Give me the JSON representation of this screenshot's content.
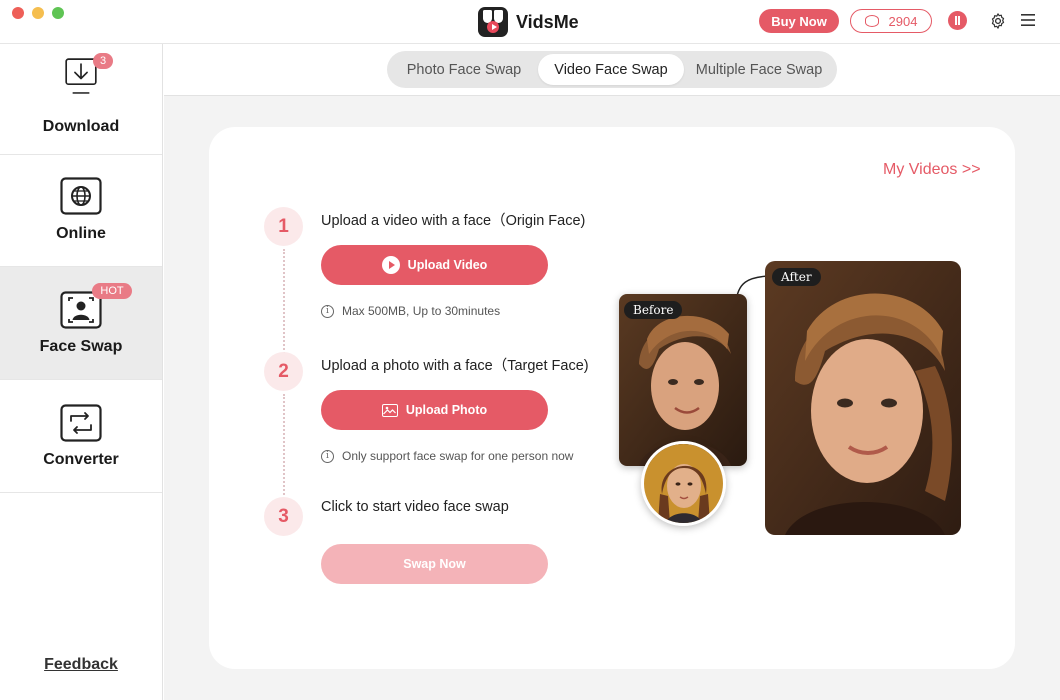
{
  "app": {
    "name": "VidsMe",
    "buy_label": "Buy Now",
    "credits": "2904"
  },
  "sidebar": {
    "items": [
      {
        "label": "Download",
        "icon": "download-icon",
        "badge": "3"
      },
      {
        "label": "Online",
        "icon": "globe-icon"
      },
      {
        "label": "Face Swap",
        "icon": "face-scan-icon",
        "badge": "HOT",
        "active": true
      },
      {
        "label": "Converter",
        "icon": "convert-icon"
      }
    ],
    "feedback_label": "Feedback"
  },
  "tabs": [
    {
      "label": "Photo Face Swap"
    },
    {
      "label": "Video Face Swap",
      "selected": true
    },
    {
      "label": "Multiple Face Swap"
    }
  ],
  "main": {
    "my_videos_link": "My Videos >>",
    "steps": [
      {
        "number": "1",
        "text": "Upload a video with a face（Origin Face)",
        "button_label": "Upload Video",
        "note": "Max 500MB, Up to 30minutes"
      },
      {
        "number": "2",
        "text": "Upload a photo with a face（Target Face)",
        "button_label": "Upload Photo",
        "note": "Only support face swap for one person now"
      },
      {
        "number": "3",
        "text": "Click to start video face swap",
        "button_label": "Swap Now",
        "button_disabled": true
      }
    ],
    "illustration": {
      "before_label": "Before",
      "after_label": "After"
    }
  },
  "colors": {
    "accent": "#e55a66",
    "accent_light": "#fbe9ea",
    "disabled": "#f4b3b8"
  }
}
